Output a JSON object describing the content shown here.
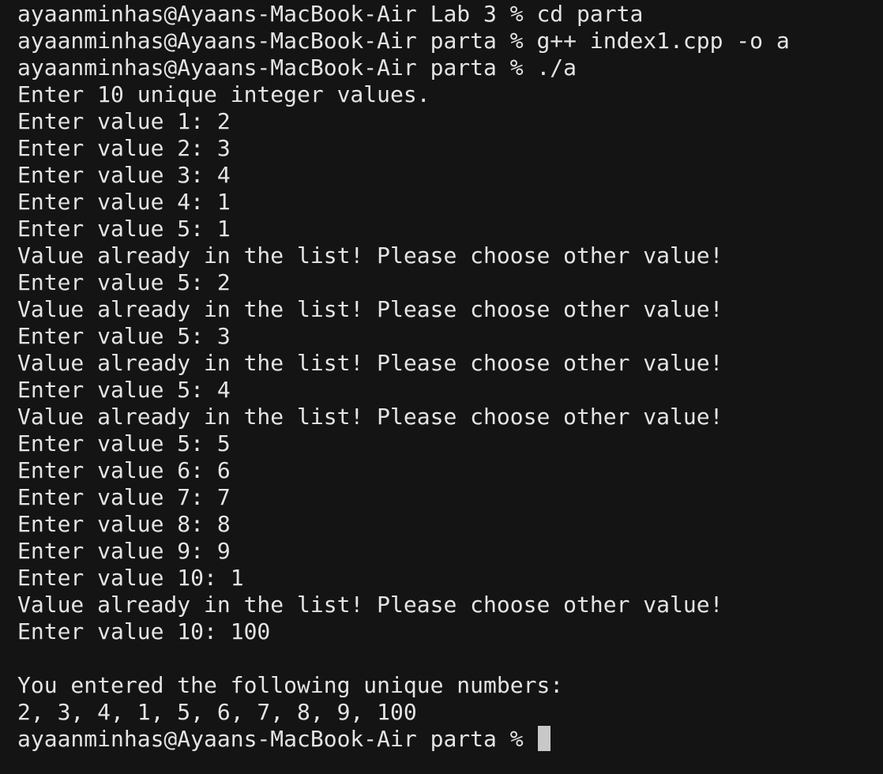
{
  "terminal": {
    "lines": [
      "ayaanminhas@Ayaans-MacBook-Air Lab 3 % cd parta",
      "ayaanminhas@Ayaans-MacBook-Air parta % g++ index1.cpp -o a",
      "ayaanminhas@Ayaans-MacBook-Air parta % ./a",
      "Enter 10 unique integer values.",
      "Enter value 1: 2",
      "Enter value 2: 3",
      "Enter value 3: 4",
      "Enter value 4: 1",
      "Enter value 5: 1",
      "Value already in the list! Please choose other value!",
      "Enter value 5: 2",
      "Value already in the list! Please choose other value!",
      "Enter value 5: 3",
      "Value already in the list! Please choose other value!",
      "Enter value 5: 4",
      "Value already in the list! Please choose other value!",
      "Enter value 5: 5",
      "Enter value 6: 6",
      "Enter value 7: 7",
      "Enter value 8: 8",
      "Enter value 9: 9",
      "Enter value 10: 1",
      "Value already in the list! Please choose other value!",
      "Enter value 10: 100",
      "",
      "You entered the following unique numbers:",
      "2, 3, 4, 1, 5, 6, 7, 8, 9, 100"
    ],
    "prompt": "ayaanminhas@Ayaans-MacBook-Air parta % ",
    "colors": {
      "background": "#141414",
      "text": "#e4e4e4",
      "cursor": "#c8c8c8"
    }
  }
}
